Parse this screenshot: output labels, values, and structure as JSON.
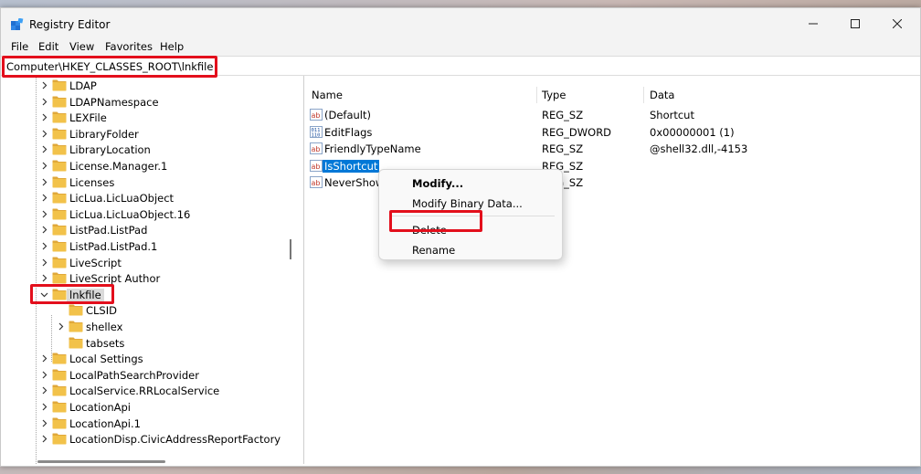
{
  "window": {
    "title": "Registry Editor",
    "minimize_glyph": "—",
    "maximize_glyph": "☐",
    "close_glyph": "✕"
  },
  "menu": {
    "items": [
      "File",
      "Edit",
      "View",
      "Favorites",
      "Help"
    ]
  },
  "address": {
    "path": "Computer\\HKEY_CLASSES_ROOT\\lnkfile"
  },
  "tree": {
    "items": [
      {
        "label": "LDAP",
        "expander": "collapsed"
      },
      {
        "label": "LDAPNamespace",
        "expander": "collapsed"
      },
      {
        "label": "LEXFile",
        "expander": "collapsed"
      },
      {
        "label": "LibraryFolder",
        "expander": "collapsed"
      },
      {
        "label": "LibraryLocation",
        "expander": "collapsed"
      },
      {
        "label": "License.Manager.1",
        "expander": "collapsed"
      },
      {
        "label": "Licenses",
        "expander": "collapsed"
      },
      {
        "label": "LicLua.LicLuaObject",
        "expander": "collapsed"
      },
      {
        "label": "LicLua.LicLuaObject.16",
        "expander": "collapsed"
      },
      {
        "label": "ListPad.ListPad",
        "expander": "collapsed"
      },
      {
        "label": "ListPad.ListPad.1",
        "expander": "collapsed"
      },
      {
        "label": "LiveScript",
        "expander": "collapsed"
      },
      {
        "label": "LiveScript Author",
        "expander": "collapsed"
      },
      {
        "label": "lnkfile",
        "expander": "expanded",
        "selected": true
      },
      {
        "label": "CLSID",
        "expander": "none",
        "child": true
      },
      {
        "label": "shellex",
        "expander": "collapsed",
        "child": true
      },
      {
        "label": "tabsets",
        "expander": "none",
        "child": true
      },
      {
        "label": "Local Settings",
        "expander": "collapsed"
      },
      {
        "label": "LocalPathSearchProvider",
        "expander": "collapsed"
      },
      {
        "label": "LocalService.RRLocalService",
        "expander": "collapsed"
      },
      {
        "label": "LocationApi",
        "expander": "collapsed"
      },
      {
        "label": "LocationApi.1",
        "expander": "collapsed"
      },
      {
        "label": "LocationDisp.CivicAddressReportFactory",
        "expander": "collapsed"
      }
    ]
  },
  "values": {
    "columns": [
      "Name",
      "Type",
      "Data"
    ],
    "rows": [
      {
        "name": "(Default)",
        "type": "REG_SZ",
        "data": "Shortcut",
        "icon": "string-value-icon"
      },
      {
        "name": "EditFlags",
        "type": "REG_DWORD",
        "data": "0x00000001 (1)",
        "icon": "binary-value-icon"
      },
      {
        "name": "FriendlyTypeName",
        "type": "REG_SZ",
        "data": "@shell32.dll,-4153",
        "icon": "string-value-icon"
      },
      {
        "name": "IsShortcut",
        "type": "REG_SZ",
        "data": "",
        "icon": "string-value-icon",
        "selected": true
      },
      {
        "name": "NeverShow",
        "type": "REG_SZ",
        "data": "",
        "icon": "string-value-icon"
      }
    ]
  },
  "context_menu": {
    "items": [
      "Modify...",
      "Modify Binary Data...",
      "Delete",
      "Rename"
    ]
  },
  "colors": {
    "highlight": "#e30f1c",
    "selection": "#0078d7",
    "folder": "#f2c24a"
  }
}
